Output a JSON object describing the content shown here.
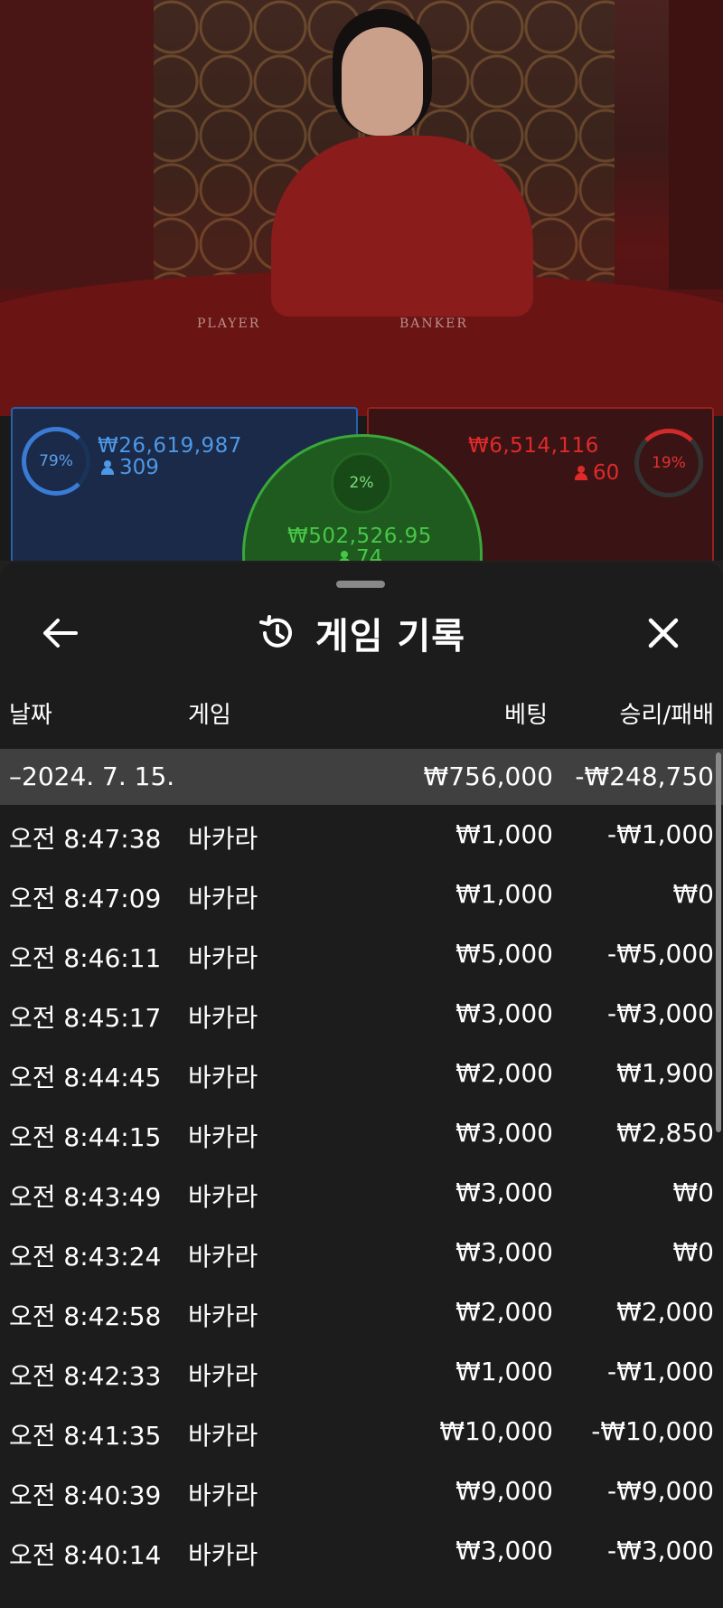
{
  "table": {
    "label_player": "PLAYER",
    "label_banker": "BANKER",
    "player": {
      "percent": "79%",
      "amount": "₩26,619,987",
      "players": "309"
    },
    "banker": {
      "percent": "19%",
      "amount": "₩6,514,116",
      "players": "60"
    },
    "tie": {
      "percent": "2%",
      "amount": "₩502,526.95",
      "players": "74"
    },
    "colors": {
      "player": "#3a7bd5",
      "banker": "#e02a2a",
      "tie": "#46c846"
    }
  },
  "history": {
    "title": "게임 기록",
    "icons": {
      "back": "arrow-left-icon",
      "title": "history-icon",
      "close": "close-icon"
    },
    "columns": {
      "date": "날짜",
      "game": "게임",
      "bet": "베팅",
      "result": "승리/패배"
    },
    "summary": {
      "date": "–2024. 7. 15.",
      "bet": "₩756,000",
      "result": "-₩248,750"
    },
    "rows": [
      {
        "time": "오전 8:47:38",
        "game": "바카라",
        "bet": "₩1,000",
        "result": "-₩1,000"
      },
      {
        "time": "오전 8:47:09",
        "game": "바카라",
        "bet": "₩1,000",
        "result": "₩0"
      },
      {
        "time": "오전 8:46:11",
        "game": "바카라",
        "bet": "₩5,000",
        "result": "-₩5,000"
      },
      {
        "time": "오전 8:45:17",
        "game": "바카라",
        "bet": "₩3,000",
        "result": "-₩3,000"
      },
      {
        "time": "오전 8:44:45",
        "game": "바카라",
        "bet": "₩2,000",
        "result": "₩1,900"
      },
      {
        "time": "오전 8:44:15",
        "game": "바카라",
        "bet": "₩3,000",
        "result": "₩2,850"
      },
      {
        "time": "오전 8:43:49",
        "game": "바카라",
        "bet": "₩3,000",
        "result": "₩0"
      },
      {
        "time": "오전 8:43:24",
        "game": "바카라",
        "bet": "₩3,000",
        "result": "₩0"
      },
      {
        "time": "오전 8:42:58",
        "game": "바카라",
        "bet": "₩2,000",
        "result": "₩2,000"
      },
      {
        "time": "오전 8:42:33",
        "game": "바카라",
        "bet": "₩1,000",
        "result": "-₩1,000"
      },
      {
        "time": "오전 8:41:35",
        "game": "바카라",
        "bet": "₩10,000",
        "result": "-₩10,000"
      },
      {
        "time": "오전 8:40:39",
        "game": "바카라",
        "bet": "₩9,000",
        "result": "-₩9,000"
      },
      {
        "time": "오전 8:40:14",
        "game": "바카라",
        "bet": "₩3,000",
        "result": "-₩3,000"
      }
    ]
  }
}
